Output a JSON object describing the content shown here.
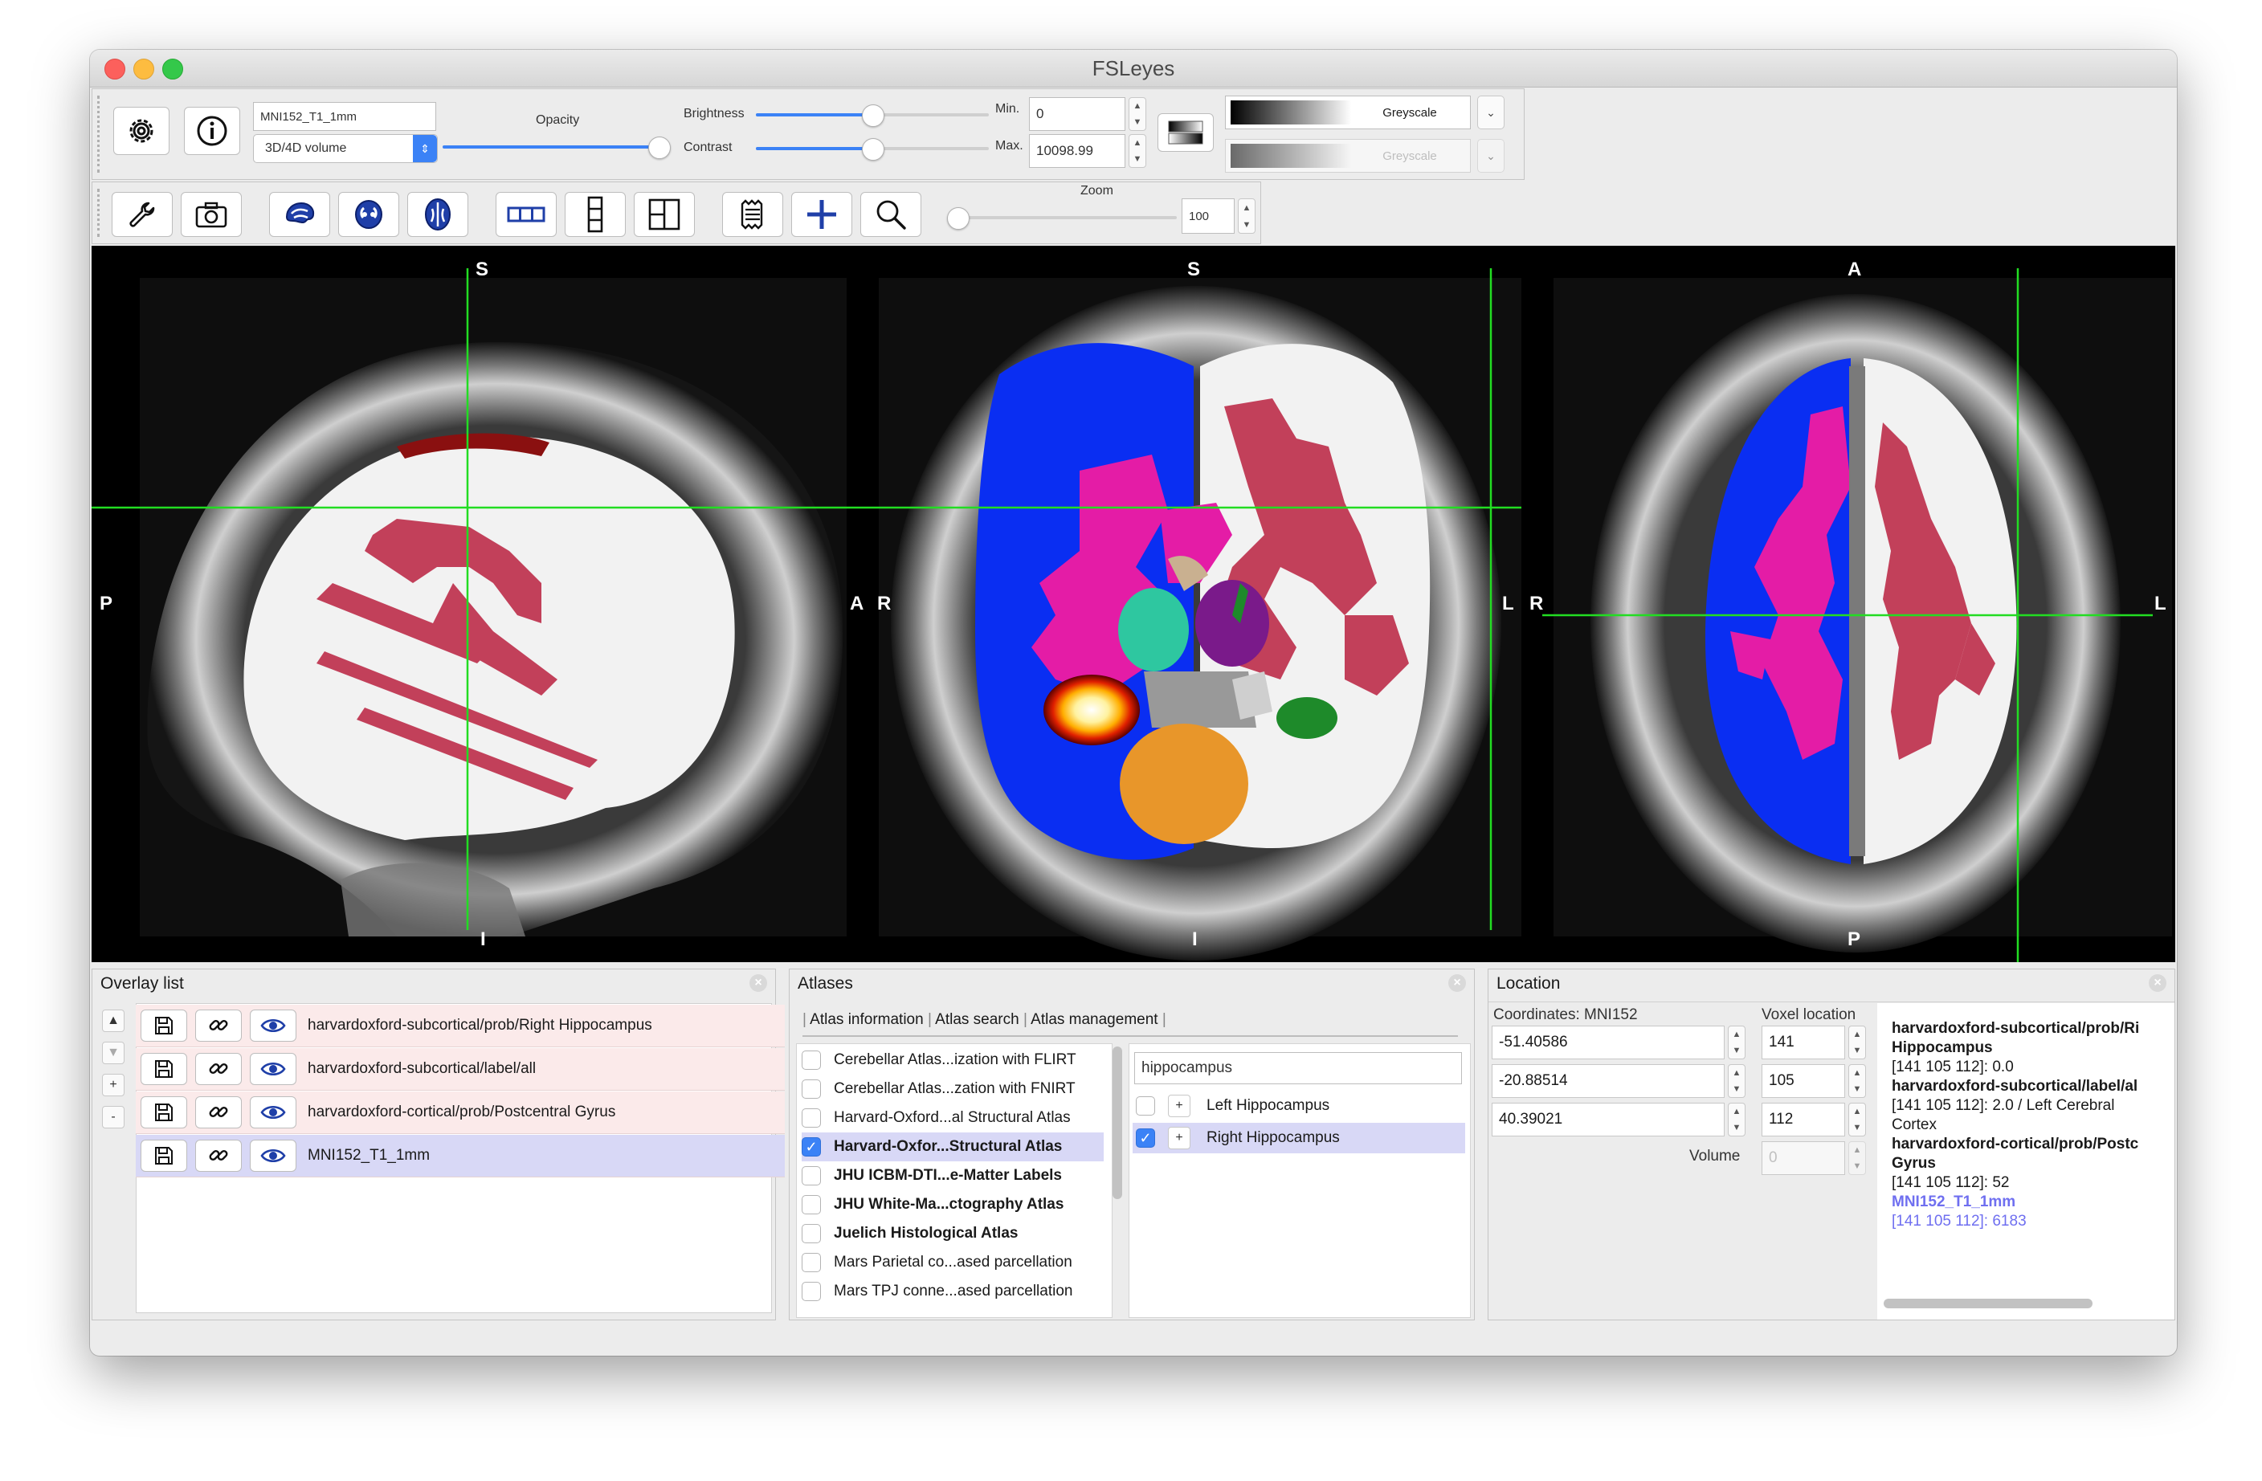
{
  "window": {
    "title": "FSLeyes"
  },
  "overlay_toolbar": {
    "overlay_name": "MNI152_T1_1mm",
    "volume_type": "3D/4D volume",
    "opacity_label": "Opacity",
    "brightness_label": "Brightness",
    "contrast_label": "Contrast",
    "min_label": "Min.",
    "max_label": "Max.",
    "min_value": "0",
    "max_value": "10098.99",
    "colormap": "Greyscale",
    "neg_colormap": "Greyscale",
    "opacity": 1.0,
    "brightness": 0.5,
    "contrast": 0.5
  },
  "ortho_toolbar": {
    "zoom_label": "Zoom",
    "zoom_value": "100",
    "zoom": 0.0
  },
  "views": {
    "sagittal": {
      "top": "S",
      "bottom": "I",
      "left": "P",
      "right": "A"
    },
    "coronal": {
      "top": "S",
      "bottom": "I",
      "left": "R",
      "right": "L"
    },
    "axial": {
      "top": "A",
      "bottom": "P",
      "left": "R",
      "right": "L"
    }
  },
  "overlay_list": {
    "title": "Overlay list",
    "items": [
      {
        "name": "harvardoxford-subcortical/prob/Right Hippocampus",
        "selected": false
      },
      {
        "name": "harvardoxford-subcortical/label/all",
        "selected": false
      },
      {
        "name": "harvardoxford-cortical/prob/Postcentral Gyrus",
        "selected": false
      },
      {
        "name": "MNI152_T1_1mm",
        "selected": true
      }
    ],
    "controls": {
      "up": "▲",
      "down": "▼",
      "add": "+",
      "remove": "-"
    }
  },
  "atlases": {
    "title": "Atlases",
    "tabs": [
      "Atlas information",
      "Atlas search",
      "Atlas management"
    ],
    "list": [
      {
        "name": "Cerebellar Atlas...ization with FLIRT",
        "checked": false,
        "bold": false
      },
      {
        "name": "Cerebellar Atlas...zation with FNIRT",
        "checked": false,
        "bold": false
      },
      {
        "name": "Harvard-Oxford...al Structural Atlas",
        "checked": false,
        "bold": false
      },
      {
        "name": "Harvard-Oxfor...Structural Atlas",
        "checked": true,
        "bold": true
      },
      {
        "name": "JHU ICBM-DTI...e-Matter Labels",
        "checked": false,
        "bold": true
      },
      {
        "name": "JHU White-Ma...ctography Atlas",
        "checked": false,
        "bold": true
      },
      {
        "name": "Juelich Histological Atlas",
        "checked": false,
        "bold": true
      },
      {
        "name": "Mars Parietal co...ased parcellation",
        "checked": false,
        "bold": false
      },
      {
        "name": "Mars TPJ conne...ased parcellation",
        "checked": false,
        "bold": false
      }
    ],
    "search_value": "hippocampus",
    "regions": [
      {
        "name": "Left Hippocampus",
        "checked": false
      },
      {
        "name": "Right Hippocampus",
        "checked": true
      }
    ]
  },
  "location": {
    "title": "Location",
    "coords_label": "Coordinates: MNI152",
    "voxel_label": "Voxel location",
    "coords": [
      "-51.40586",
      "-20.88514",
      "40.39021"
    ],
    "voxels": [
      "141",
      "105",
      "112"
    ],
    "volume_label": "Volume",
    "volume_value": "0",
    "info": [
      {
        "text": "harvardoxford-subcortical/prob/Ri",
        "bold": true,
        "color": "#1a1a1a"
      },
      {
        "text": "Hippocampus",
        "bold": true,
        "color": "#1a1a1a"
      },
      {
        "text": "[141 105 112]: 0.0",
        "bold": false,
        "color": "#1a1a1a"
      },
      {
        "text": "harvardoxford-subcortical/label/al",
        "bold": true,
        "color": "#1a1a1a"
      },
      {
        "text": "[141 105 112]: 2.0 / Left Cerebral",
        "bold": false,
        "color": "#1a1a1a"
      },
      {
        "text": "Cortex",
        "bold": false,
        "color": "#1a1a1a"
      },
      {
        "text": "harvardoxford-cortical/prob/Postc",
        "bold": true,
        "color": "#1a1a1a"
      },
      {
        "text": "Gyrus",
        "bold": true,
        "color": "#1a1a1a"
      },
      {
        "text": "[141 105 112]: 52",
        "bold": false,
        "color": "#1a1a1a"
      },
      {
        "text": "MNI152_T1_1mm",
        "bold": true,
        "color": "#6f6ff0"
      },
      {
        "text": "[141 105 112]: 6183",
        "bold": false,
        "color": "#6f6ff0"
      }
    ]
  },
  "colors": {
    "accent": "#3b82f6",
    "crosshair": "#22dd22",
    "cortex_white": "#f2f2f2",
    "label_red": "#c2405a",
    "label_magenta": "#e41ca6",
    "label_blue": "#0a2ef2",
    "label_teal": "#2ec7a0",
    "label_purple": "#7a1a8a",
    "label_orange": "#e8962a",
    "label_green": "#1e8a2a"
  },
  "icons": [
    "gear-icon",
    "info-icon",
    "wrench-icon",
    "camera-icon",
    "sagittal-view-icon",
    "coronal-view-icon",
    "axial-view-icon",
    "horizontal-layout-icon",
    "vertical-layout-icon",
    "grid-layout-icon",
    "movie-icon",
    "crosshair-icon",
    "zoom-icon",
    "save-icon",
    "link-icon",
    "eye-icon",
    "close-icon"
  ]
}
